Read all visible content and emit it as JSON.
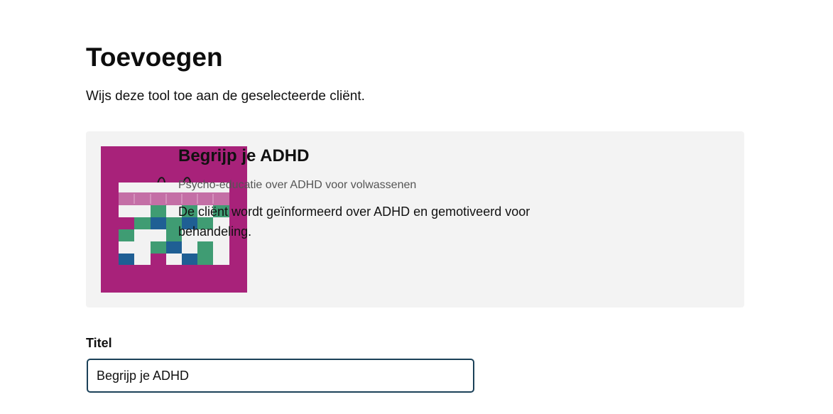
{
  "page": {
    "title": "Toevoegen",
    "subtitle": "Wijs deze tool toe aan de geselecteerde cliënt."
  },
  "tool": {
    "name": "Begrijp je ADHD",
    "category": "Psycho-educatie over ADHD voor volwassenen",
    "description": "De cliënt wordt geïnformeerd over ADHD en gemotiveerd voor behandeling.",
    "image_icon": "calendar-illustration-icon",
    "colors": {
      "background": "#a8227a",
      "green": "#3f9c73",
      "blue": "#1f5f94",
      "white": "#f2f2f2",
      "pink_header": "#c46fa6"
    }
  },
  "form": {
    "title_label": "Titel",
    "title_value": "Begrijp je ADHD"
  },
  "theme": {
    "card_background": "#f3f3f3",
    "input_border": "#1b4159"
  }
}
